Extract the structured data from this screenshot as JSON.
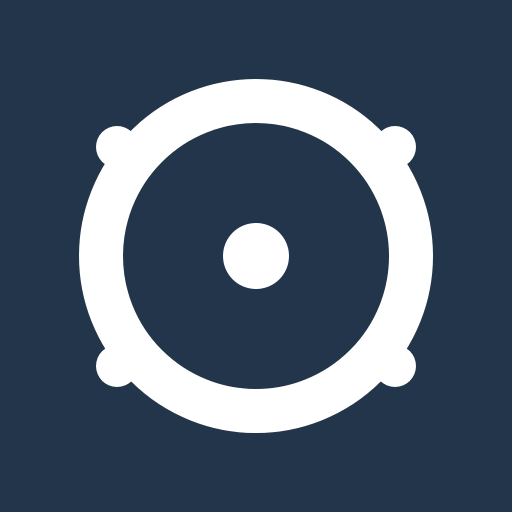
{
  "icon": {
    "name": "speaker-icon",
    "background_color": "#22354a",
    "foreground_color": "#ffffff"
  }
}
